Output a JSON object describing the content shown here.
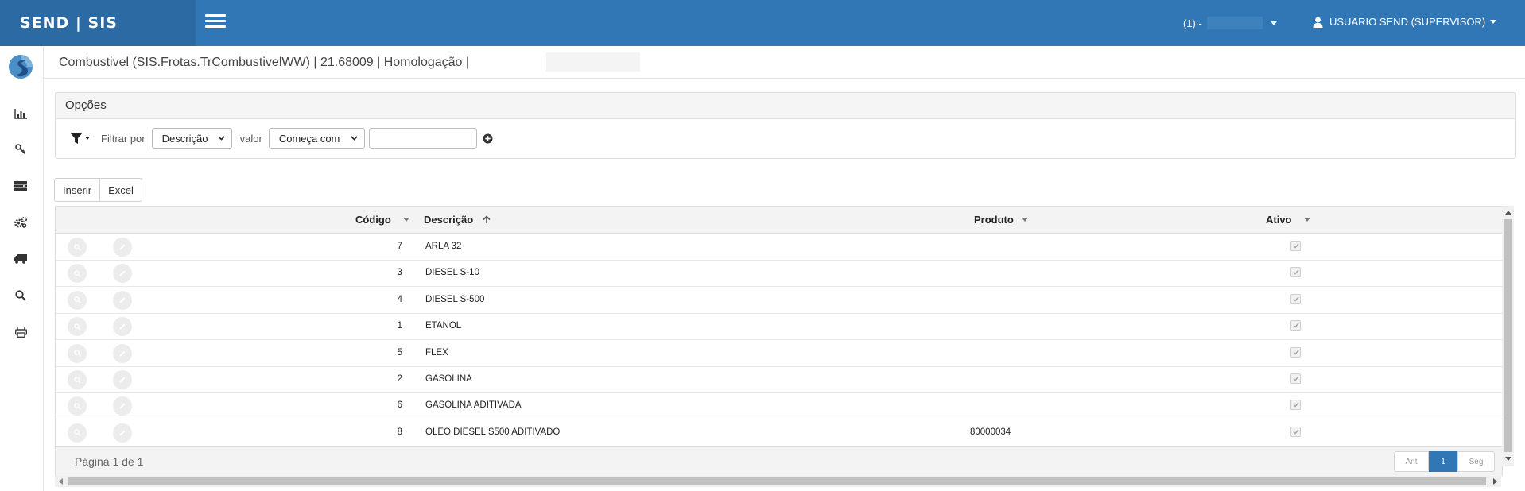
{
  "app": {
    "brand": "SEND | SIS",
    "env_selector_label": "(1) -",
    "user_label": "USUARIO SEND (SUPERVISOR)"
  },
  "header": {
    "title": "Combustivel (SIS.Frotas.TrCombustivelWW) | 21.68009 | Homologação |"
  },
  "options": {
    "panel_title": "Opções",
    "filter_by_label": "Filtrar por",
    "filter_field_selected": "Descrição",
    "value_label": "valor",
    "operator_selected": "Começa com",
    "value_input": ""
  },
  "toolbar": {
    "insert_label": "Inserir",
    "excel_label": "Excel"
  },
  "grid": {
    "columns": [
      "Código",
      "Descrição",
      "Produto",
      "Ativo"
    ],
    "rows": [
      {
        "codigo": "7",
        "descricao": "ARLA 32",
        "produto": "",
        "ativo": true
      },
      {
        "codigo": "3",
        "descricao": "DIESEL S-10",
        "produto": "",
        "ativo": true
      },
      {
        "codigo": "4",
        "descricao": "DIESEL S-500",
        "produto": "",
        "ativo": true
      },
      {
        "codigo": "1",
        "descricao": "ETANOL",
        "produto": "",
        "ativo": true
      },
      {
        "codigo": "5",
        "descricao": "FLEX",
        "produto": "",
        "ativo": true
      },
      {
        "codigo": "2",
        "descricao": "GASOLINA",
        "produto": "",
        "ativo": true
      },
      {
        "codigo": "6",
        "descricao": "GASOLINA ADITIVADA",
        "produto": "",
        "ativo": true
      },
      {
        "codigo": "8",
        "descricao": "OLEO DIESEL S500 ADITIVADO",
        "produto": "80000034",
        "ativo": true
      }
    ],
    "page_info": "Página 1 de 1",
    "pager": {
      "prev": "Ant",
      "current": "1",
      "next": "Seg"
    }
  },
  "sidebar": {
    "icons": [
      "chart-icon",
      "key-icon",
      "list-icon",
      "cogs-icon",
      "truck-icon",
      "search-icon",
      "print-icon"
    ]
  },
  "colors": {
    "brand_bar": "#3277b5",
    "brand_dark": "#2b6aa3",
    "active_page": "#3277b5"
  }
}
